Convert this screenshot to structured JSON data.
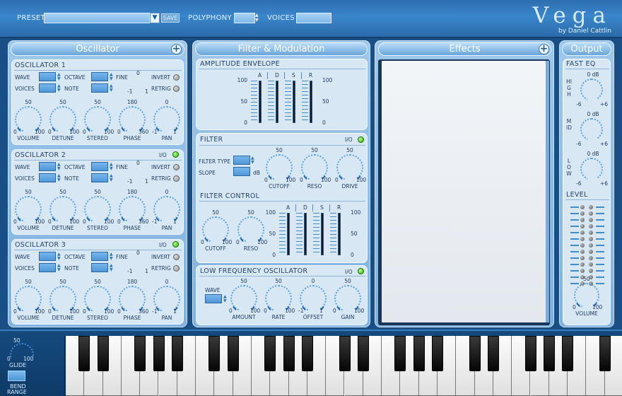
{
  "top": {
    "preset_label": "PRESET",
    "save_label": "SAVE",
    "polyphony_label": "POLYPHONY",
    "voices_label": "VOICES",
    "title": "Vega",
    "byline": "by Daniel Cattlin"
  },
  "sections": {
    "oscillator": "Oscillator",
    "filter_mod": "Filter & Modulation",
    "effects": "Effects",
    "output": "Output"
  },
  "osc_labels": {
    "wave": "WAVE",
    "voices": "VOICES",
    "octave": "OCTAVE",
    "note": "NOTE",
    "fine": "FINE",
    "fine_zero": "0",
    "fine_min": "-1",
    "fine_max": "1",
    "invert": "INVERT",
    "retrig": "RETRIG",
    "io": "I/O"
  },
  "oscillators": [
    {
      "title": "OSCILLATOR 1",
      "has_io": false
    },
    {
      "title": "OSCILLATOR 2",
      "has_io": true
    },
    {
      "title": "OSCILLATOR 3",
      "has_io": true
    }
  ],
  "osc_knobs": [
    {
      "name": "VOLUME",
      "top": "50",
      "min": "0",
      "max": "100"
    },
    {
      "name": "DETUNE",
      "top": "50",
      "min": "0",
      "max": "100"
    },
    {
      "name": "STEREO",
      "top": "50",
      "min": "0",
      "max": "100"
    },
    {
      "name": "PHASE",
      "top": "180",
      "min": "0",
      "max": "360"
    },
    {
      "name": "PAN",
      "top": "0",
      "min": "-1",
      "max": "1"
    }
  ],
  "amp_env": {
    "title": "AMPLITUDE ENVELOPE",
    "adsr": [
      "A",
      "D",
      "S",
      "R"
    ],
    "scale_left": [
      "100",
      "50",
      "0"
    ],
    "scale_right": [
      "100",
      "50",
      "0"
    ]
  },
  "filter": {
    "title": "FILTER",
    "io": "I/O",
    "type_label": "FILTER TYPE",
    "slope_label": "SLOPE",
    "slope_unit": "dB",
    "knobs": [
      {
        "name": "CUTOFF",
        "top": "50",
        "min": "0",
        "max": "100"
      },
      {
        "name": "RESO",
        "top": "50",
        "min": "0",
        "max": "100"
      },
      {
        "name": "DRIVE",
        "top": "50",
        "min": "0",
        "max": "100"
      }
    ]
  },
  "filter_control": {
    "title": "FILTER CONTROL",
    "knobs": [
      {
        "name": "CUTOFF",
        "top": "50",
        "min": "0",
        "max": "100"
      },
      {
        "name": "RESO",
        "top": "50",
        "min": "0",
        "max": "100"
      }
    ],
    "adsr": [
      "A",
      "D",
      "S",
      "R"
    ],
    "scale_left": [
      "100",
      "50",
      "0"
    ],
    "scale_right": [
      "100",
      "50",
      "0"
    ]
  },
  "lfo": {
    "title": "LOW FREQUENCY OSCILLATOR",
    "io": "I/O",
    "wave_label": "WAVE",
    "knobs": [
      {
        "name": "AMOUNT",
        "top": "50",
        "min": "0",
        "max": "100"
      },
      {
        "name": "RATE",
        "top": "50",
        "min": "0",
        "max": "100"
      },
      {
        "name": "OFFSET",
        "top": "0",
        "min": "-1",
        "max": "1"
      },
      {
        "name": "GAIN",
        "top": "50",
        "min": "0",
        "max": "100"
      }
    ]
  },
  "output": {
    "fast_eq": "FAST EQ",
    "eq": [
      {
        "name": "HIGH",
        "top": "0 dB",
        "min": "-6",
        "max": "+6"
      },
      {
        "name": "MID",
        "top": "0 dB",
        "min": "-6",
        "max": "+6"
      },
      {
        "name": "LOW",
        "top": "0 dB",
        "min": "-6",
        "max": "+6"
      }
    ],
    "level": "LEVEL",
    "volume": {
      "name": "VOLUME",
      "top": "50",
      "min": "0",
      "max": "100"
    }
  },
  "keyboard": {
    "glide_top": "50",
    "glide_min": "0",
    "glide_max": "100",
    "glide_label": "GLIDE",
    "bend_label": "BEND",
    "range_label": "RANGE"
  }
}
